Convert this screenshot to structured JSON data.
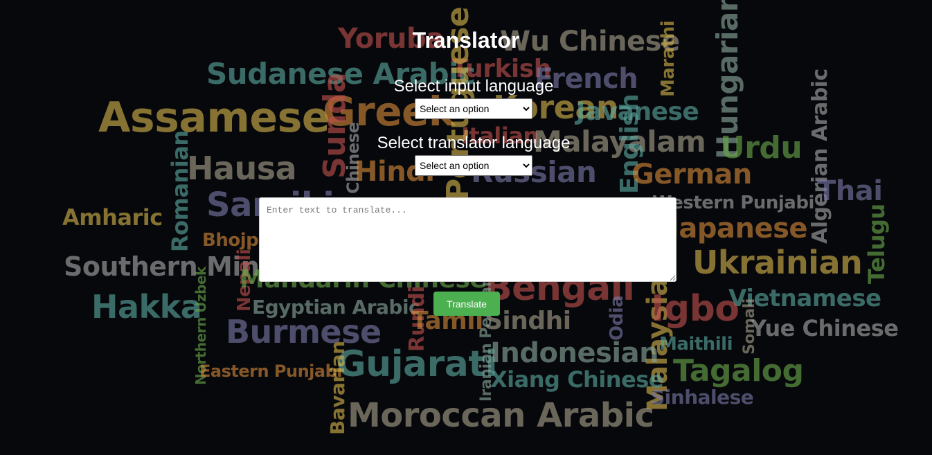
{
  "app": {
    "title": "Translator"
  },
  "input_language": {
    "label": "Select input language",
    "selected": "Select an option"
  },
  "target_language": {
    "label": "Select translator language",
    "selected": "Select an option"
  },
  "source_text": {
    "value": "",
    "placeholder": "Enter text to translate..."
  },
  "translate_button": {
    "label": "Translate",
    "color": "#4caf50"
  },
  "background": {
    "color": "#07080c",
    "words": [
      "Yoruba",
      "Wu Chinese",
      "Sudanese Arabic",
      "Turkish",
      "French",
      "Marathi",
      "Hungarian",
      "Assamese",
      "Greek",
      "Korean",
      "Javanese",
      "Italian",
      "Malayalam",
      "Urdu",
      "Algerian Arabic",
      "Hausa",
      "Sunda",
      "Chinese",
      "Hindi",
      "Portuguese",
      "Russian",
      "English",
      "German",
      "Thai",
      "Romanian",
      "Amharic",
      "Saraiki",
      "Western Punjabi",
      "Japanese",
      "Bhojpuri",
      "Telugu",
      "Southern Min",
      "Nepali",
      "Mandarin Chinese",
      "Bengali",
      "Ukrainian",
      "Hakka",
      "Egyptian Arabic",
      "Rundi",
      "Vietnamese",
      "Northern Uzbek",
      "Burmese",
      "Tamil",
      "Sindhi",
      "Odia",
      "Malaysian",
      "Igbo",
      "Somali",
      "Yue Chinese",
      "Maithili",
      "Eastern Punjabi",
      "Gujarati",
      "Iranian Persian",
      "Indonesian",
      "Tagalog",
      "Bavarian",
      "Xiang Chinese",
      "Sinhalese",
      "Moroccan Arabic"
    ]
  }
}
